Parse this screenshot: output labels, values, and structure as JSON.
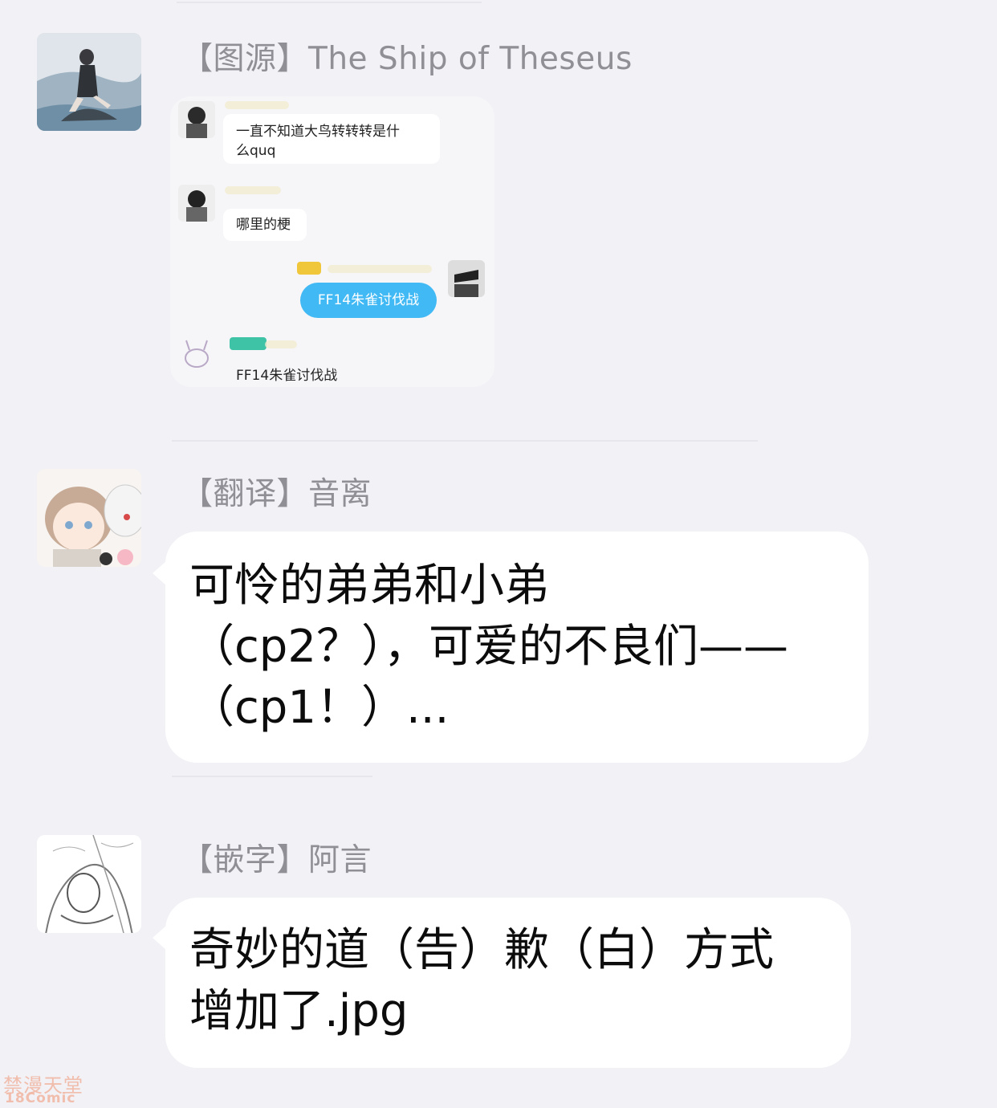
{
  "messages": [
    {
      "sender": "【图源】The Ship of Theseus",
      "avatar": "avatar-girl-on-rock-in-sea",
      "screenshot": {
        "items": [
          {
            "text": "一直不知道大鸟转转转是什\n么quq"
          },
          {
            "text": "哪里的梗"
          },
          {
            "text": "FF14朱雀讨伐战"
          },
          {
            "text": "FF14朱雀讨伐战"
          }
        ]
      }
    },
    {
      "sender": "【翻译】音离",
      "avatar": "avatar-chibi-two-boys",
      "text": "可怜的弟弟和小弟\n（cp2？），可爱的不良们——\n（cp1！）..."
    },
    {
      "sender": "【嵌字】阿言",
      "avatar": "avatar-lineart-couple",
      "text": "奇妙的道（告）歉（白）方式\n增加了.jpg"
    }
  ],
  "watermark": {
    "line1": "禁漫天堂",
    "line2": "18Comic"
  },
  "colors": {
    "background": "#f1f1f6",
    "bubble": "#ffffff",
    "sender": "#8f8f95",
    "blue_bubble": "#41b9f4"
  }
}
